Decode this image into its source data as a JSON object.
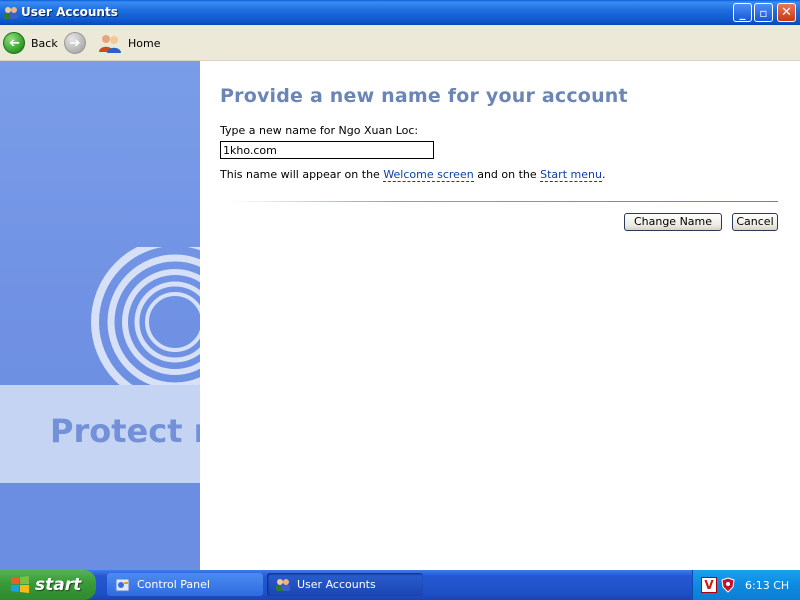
{
  "window": {
    "title": "User Accounts",
    "controls": {
      "minimize": "_",
      "maximize": "▫",
      "close": "✕"
    }
  },
  "toolbar": {
    "back_label": "Back",
    "forward_glyph": "➔",
    "back_glyph": "➔",
    "home_label": "Home"
  },
  "sidebar": {
    "banner_text": "Protect m"
  },
  "content": {
    "heading": "Provide a new name for your account",
    "prompt": "Type a new name for Ngo Xuan Loc:",
    "name_value": "1kho.com",
    "note_prefix": "This name will appear on the ",
    "link_welcome": "Welcome screen",
    "note_middle": " and on the ",
    "link_start_menu": "Start menu",
    "note_suffix": ".",
    "change_button": "Change Name",
    "cancel_button": "Cancel"
  },
  "taskbar": {
    "start_label": "start",
    "tasks": [
      {
        "label": "Control Panel"
      },
      {
        "label": "User Accounts"
      }
    ],
    "tray_v": "V",
    "clock": "6:13 CH"
  }
}
